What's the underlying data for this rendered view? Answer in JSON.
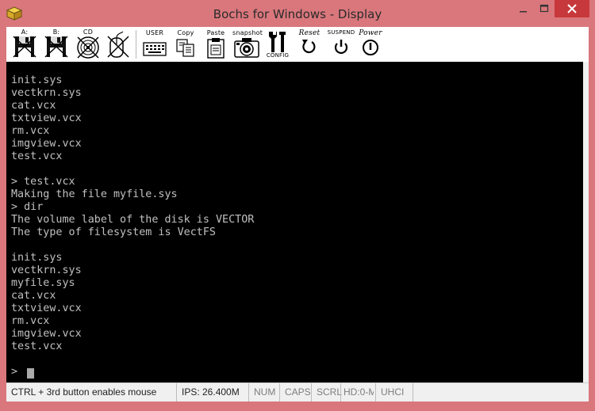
{
  "window": {
    "title": "Bochs for Windows - Display"
  },
  "toolbar": {
    "floppy_a_label": "A:",
    "floppy_b_label": "B:",
    "cdrom_label": "CD",
    "user_label": "USER",
    "copy_label": "Copy",
    "paste_label": "Paste",
    "snapshot_label": "snapshot",
    "config_label": "CONFIG",
    "reset_label": "Reset",
    "suspend_label": "SUSPEND",
    "power_label": "Power"
  },
  "terminal": {
    "lines": [
      "init.sys",
      "vectkrn.sys",
      "cat.vcx",
      "txtview.vcx",
      "rm.vcx",
      "imgview.vcx",
      "test.vcx",
      "",
      "> test.vcx",
      "Making the file myfile.sys",
      "> dir",
      "The volume label of the disk is VECTOR",
      "The type of filesystem is VectFS",
      "",
      "init.sys",
      "vectkrn.sys",
      "myfile.sys",
      "cat.vcx",
      "txtview.vcx",
      "rm.vcx",
      "imgview.vcx",
      "test.vcx"
    ],
    "prompt": ">"
  },
  "statusbar": {
    "mouse_hint": "CTRL + 3rd button enables mouse",
    "ips": "IPS: 26.400M",
    "num": "NUM",
    "caps": "CAPS",
    "scrl": "SCRL",
    "hd": "HD:0-M",
    "uhci": "UHCI"
  }
}
